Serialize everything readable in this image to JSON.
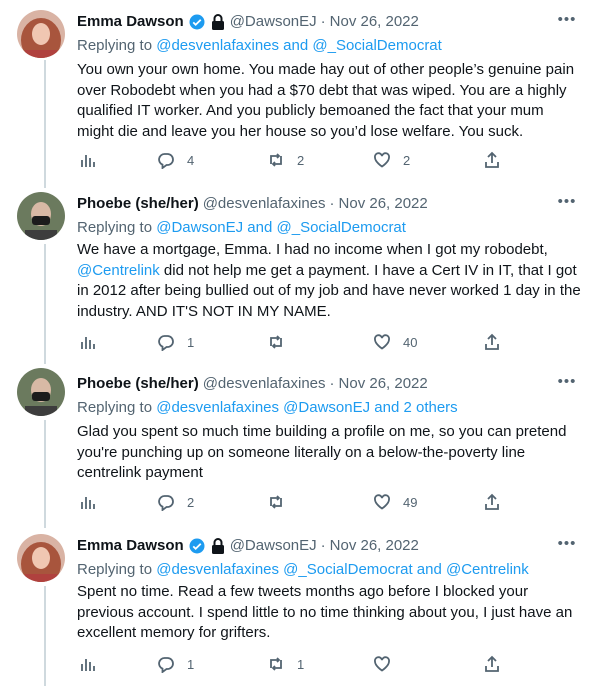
{
  "tweets": [
    {
      "name": "Emma Dawson",
      "verified": true,
      "locked": true,
      "handle": "@DawsonEJ",
      "dot": "·",
      "date": "Nov 26, 2022",
      "replying_prefix": "Replying to ",
      "replying_links": "@desvenlafaxines and @_SocialDemocrat",
      "text": "You own your own home. You made hay out of other people’s genuine pain over Robodebt when you had a $70 debt that was wiped. You are a highly qualified IT worker. And you publicly bemoaned the fact that your mum might die and leave you her house so you’d lose welfare. You suck.",
      "actions": {
        "replies": "4",
        "retweets": "2",
        "likes": "2"
      },
      "avatar_color": "#c98d7d"
    },
    {
      "name": "Phoebe (she/her)",
      "verified": false,
      "locked": false,
      "handle": "@desvenlafaxines",
      "dot": "·",
      "date": "Nov 26, 2022",
      "replying_prefix": "Replying to ",
      "replying_links": "@DawsonEJ and @_SocialDemocrat",
      "text_link": "@Centrelink",
      "text_before": "We have a mortgage, Emma. I had no income when I got my robodebt, ",
      "text_after": " did not help me get a payment. I have a Cert IV in IT, that I got in 2012 after being bullied out of my job and have never worked 1 day in the industry. AND IT'S NOT IN MY NAME.",
      "actions": {
        "replies": "1",
        "retweets": "",
        "likes": "40"
      },
      "avatar_color": "#4d5a48"
    },
    {
      "name": "Phoebe (she/her)",
      "verified": false,
      "locked": false,
      "handle": "@desvenlafaxines",
      "dot": "·",
      "date": "Nov 26, 2022",
      "replying_prefix": "Replying to ",
      "replying_links": "@desvenlafaxines @DawsonEJ and 2 others",
      "text": "Glad you spent so much time building a profile on me, so you can pretend you're punching up on someone literally on a below-the-poverty line centrelink payment",
      "actions": {
        "replies": "2",
        "retweets": "",
        "likes": "49"
      },
      "avatar_color": "#4d5a48"
    },
    {
      "name": "Emma Dawson",
      "verified": true,
      "locked": true,
      "handle": "@DawsonEJ",
      "dot": "·",
      "date": "Nov 26, 2022",
      "replying_prefix": "Replying to ",
      "replying_links": "@desvenlafaxines @_SocialDemocrat and @Centrelink",
      "text": "Spent no time. Read a few tweets months ago before I blocked your previous account. I spend little to no time thinking about you, I just have an excellent memory for grifters.",
      "actions": {
        "replies": "1",
        "retweets": "1",
        "likes": ""
      },
      "avatar_color": "#c98d7d"
    }
  ],
  "icons": {
    "more": "more-horizontal-icon",
    "analytics": "analytics-icon",
    "reply": "reply-icon",
    "retweet": "retweet-icon",
    "like": "like-icon",
    "share": "share-icon"
  },
  "colors": {
    "link": "#1d9bf0",
    "muted": "#536471",
    "verified": "#1d9bf0",
    "thread_line": "#cfd9de"
  }
}
